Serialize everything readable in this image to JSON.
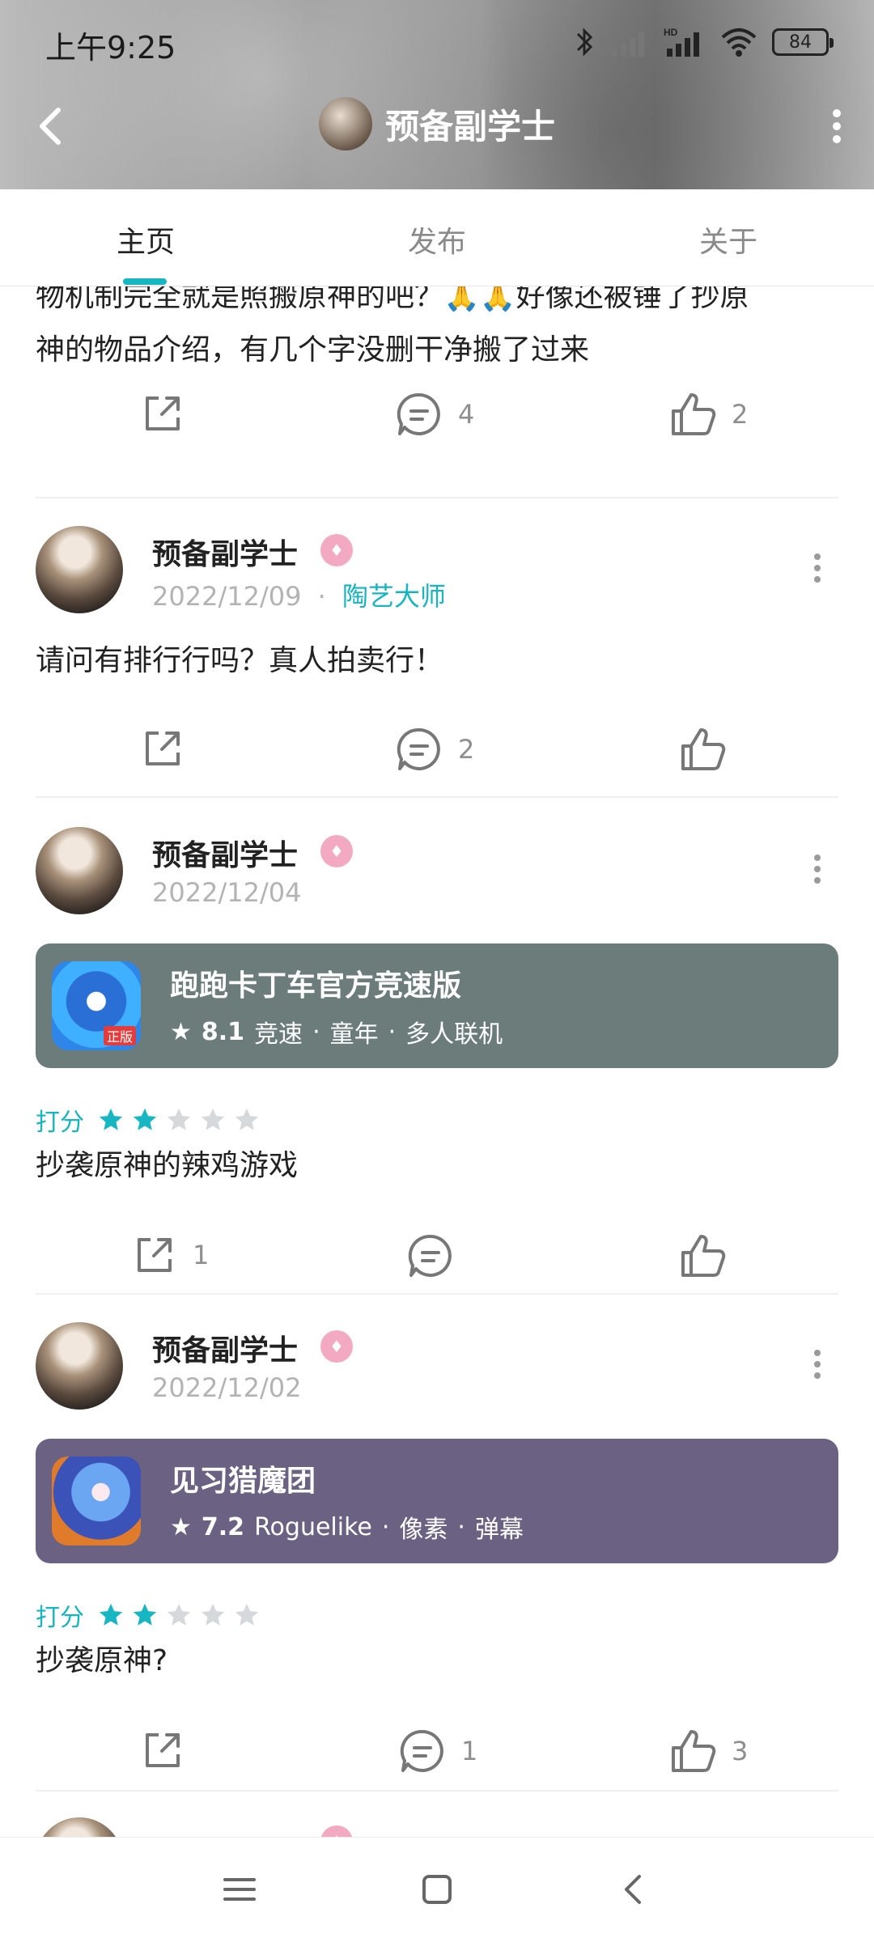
{
  "status_bar": {
    "time": "上午9:25",
    "battery": "84",
    "network": "HD"
  },
  "header": {
    "title": "预备副学士"
  },
  "tabs": [
    {
      "label": "主页",
      "active": true
    },
    {
      "label": "发布",
      "active": false
    },
    {
      "label": "关于",
      "active": false
    }
  ],
  "posts": [
    {
      "text_line1": "物机制完全就是照搬原神的吧？🙏🙏好像还被锤了抄原",
      "text_line2": "神的物品介绍，有几个字没删干净搬了过来",
      "share_count": "",
      "comment_count": "4",
      "like_count": "2"
    },
    {
      "username": "预备副学士",
      "date": "2022/12/09",
      "tag": "陶艺大师",
      "text": "请问有排行行吗？真人拍卖行！",
      "share_count": "",
      "comment_count": "2",
      "like_count": ""
    },
    {
      "username": "预备副学士",
      "date": "2022/12/04",
      "game": {
        "name": "跑跑卡丁车官方竞速版",
        "score": "8.1",
        "tags": [
          "竞速",
          "童年",
          "多人联机"
        ],
        "icon_label": "正版",
        "card_color": "#6b7c7b"
      },
      "rating_label": "打分",
      "rating_stars": 2,
      "text": "抄袭原神的辣鸡游戏",
      "share_count": "1",
      "comment_count": "",
      "like_count": ""
    },
    {
      "username": "预备副学士",
      "date": "2022/12/02",
      "game": {
        "name": "见习猎魔团",
        "score": "7.2",
        "tags": [
          "Roguelike",
          "像素",
          "弹幕"
        ],
        "card_color": "#6a6183"
      },
      "rating_label": "打分",
      "rating_stars": 2,
      "text": "抄袭原神?",
      "share_count": "",
      "comment_count": "1",
      "like_count": "3"
    }
  ],
  "colors": {
    "accent": "#16b6c2",
    "badge": "#f4a9c3",
    "star_empty": "#d5d9dc"
  }
}
